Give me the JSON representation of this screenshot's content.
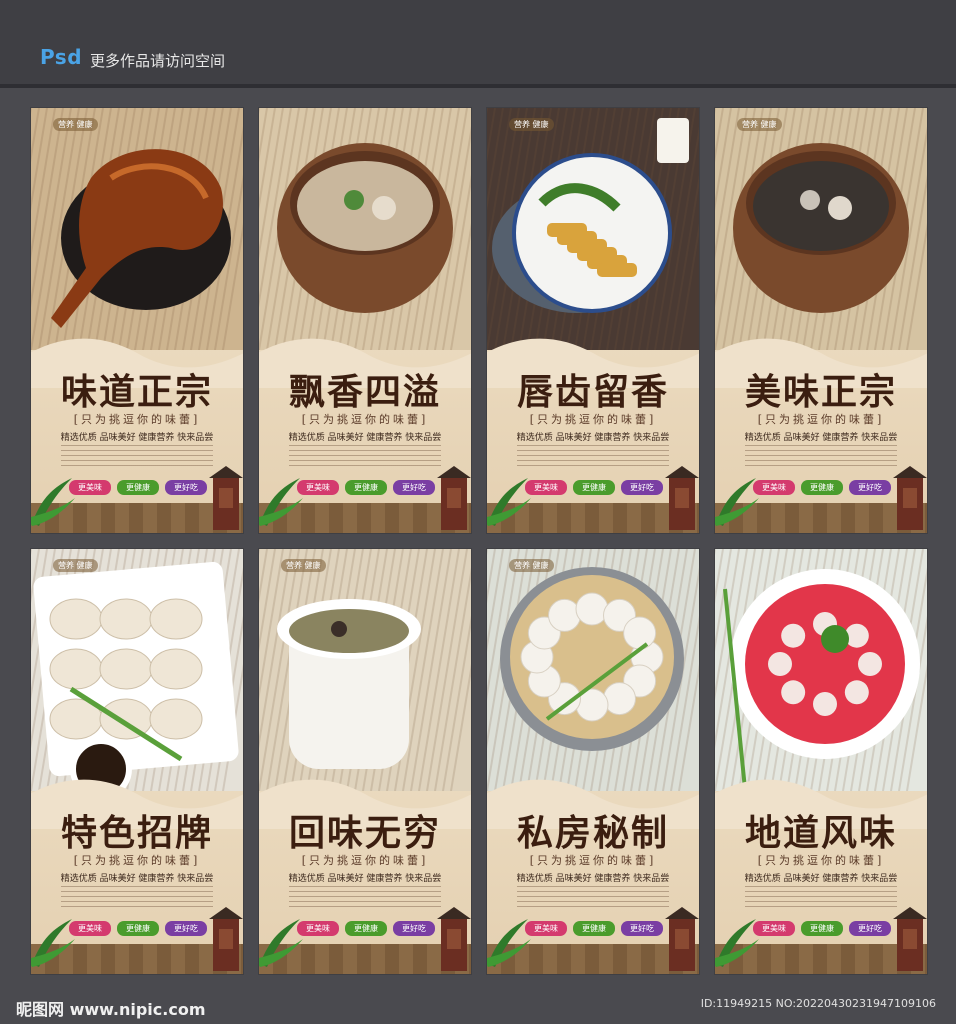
{
  "header": {
    "logo": "Psd",
    "text": "更多作品请访问空间"
  },
  "cards": [
    {
      "title": "味道正宗",
      "subtitle": "[只为挑逗你的味蕾]",
      "desc": "精选优质 品味美好 健康营养 快来品尝",
      "dish": "roast-duck",
      "tags": [
        "更美味",
        "更健康",
        "更好吃"
      ],
      "label": "营养 健康"
    },
    {
      "title": "飘香四溢",
      "subtitle": "[只为挑逗你的味蕾]",
      "desc": "精选优质 品味美好 健康营养 快来品尝",
      "dish": "clay-pot-soup",
      "tags": [
        "更美味",
        "更健康",
        "更好吃"
      ],
      "label": ""
    },
    {
      "title": "唇齿留香",
      "subtitle": "[只为挑逗你的味蕾]",
      "desc": "精选优质 品味美好 健康营养 快来品尝",
      "dish": "chicken-plate",
      "tags": [
        "更美味",
        "更健康",
        "更好吃"
      ],
      "label": "营养 健康"
    },
    {
      "title": "美味正宗",
      "subtitle": "[只为挑逗你的味蕾]",
      "desc": "精选优质 品味美好 健康营养 快来品尝",
      "dish": "herbal-soup",
      "tags": [
        "更美味",
        "更健康",
        "更好吃"
      ],
      "label": "营养 健康"
    },
    {
      "title": "特色招牌",
      "subtitle": "[只为挑逗你的味蕾]",
      "desc": "精选优质 品味美好 健康营养 快来品尝",
      "dish": "dumplings",
      "tags": [
        "更美味",
        "更健康",
        "更好吃"
      ],
      "label": "营养 健康"
    },
    {
      "title": "回味无穷",
      "subtitle": "[只为挑逗你的味蕾]",
      "desc": "精选优质 品味美好 健康营养 快来品尝",
      "dish": "stew-pot",
      "tags": [
        "更美味",
        "更健康",
        "更好吃"
      ],
      "label": "营养 健康"
    },
    {
      "title": "私房秘制",
      "subtitle": "[只为挑逗你的味蕾]",
      "desc": "精选优质 品味美好 健康营养 快来品尝",
      "dish": "steamer-dumplings",
      "tags": [
        "更美味",
        "更健康",
        "更好吃"
      ],
      "label": "营养 健康"
    },
    {
      "title": "地道风味",
      "subtitle": "[只为挑逗你的味蕾]",
      "desc": "精选优质 品味美好 健康营养 快来品尝",
      "dish": "red-soup",
      "tags": [
        "更美味",
        "更健康",
        "更好吃"
      ],
      "label": ""
    }
  ],
  "footer": {
    "logo": "昵图网 www.nipic.com",
    "id": "ID:11949215 NO:20220430231947109106"
  }
}
